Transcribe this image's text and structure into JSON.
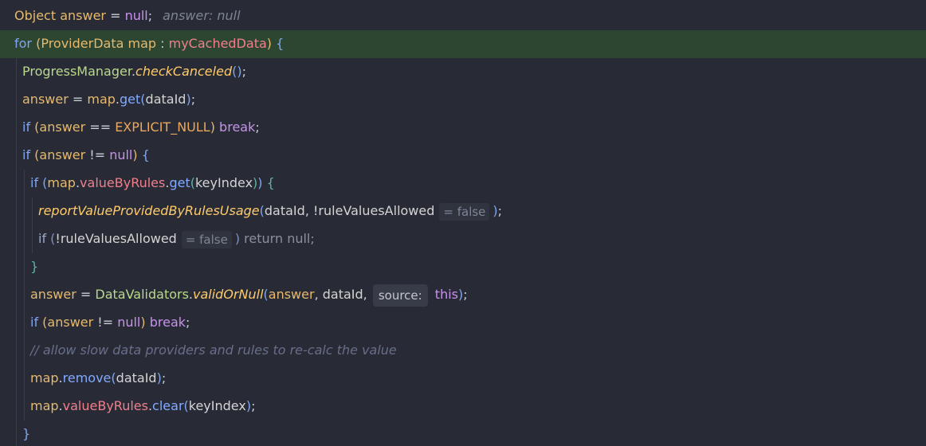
{
  "theme": {
    "colors": {
      "background": "#282b35",
      "current_line": "#2c4632",
      "indent_guide": "#3a3e4b",
      "text": "#c8ccd4",
      "keyword": "#82a4f0",
      "keyword_purple": "#c792ea",
      "type": "#e6b96e",
      "local": "#e6b96e",
      "field": "#f07f8c",
      "class": "#b8d98a",
      "static_method": "#ffcb6b",
      "method": "#82aaff",
      "param": "#d4d4d4",
      "constant": "#e9a85f",
      "comment": "#686e8a",
      "hint": "#7e8494",
      "hint_bg": "#30343f",
      "hint_box_bg": "#383c48",
      "hint_box_text": "#c4c7ce",
      "bracket_1": "#e6b96e",
      "bracket_2": "#7fa6ee",
      "bracket_3": "#5fb3a6",
      "dim": "#8a8f9b",
      "dim_keyword": "#9aa6c8",
      "dim_bracket": "#7f8fbf"
    }
  },
  "editor": {
    "current_line": 2,
    "lines": [
      {
        "depth": 0,
        "tokens": [
          {
            "text": "Object",
            "kind": "type"
          },
          {
            "text": " answer",
            "kind": "local"
          },
          {
            "text": " = ",
            "kind": "operator"
          },
          {
            "text": "null",
            "kind": "keyword-purple"
          },
          {
            "text": ";",
            "kind": "punct"
          },
          {
            "text": "answer: null",
            "kind": "hint"
          }
        ]
      },
      {
        "depth": 0,
        "tokens": [
          {
            "text": "for",
            "kind": "keyword"
          },
          {
            "text": " (",
            "kind": "bracket-1"
          },
          {
            "text": "ProviderData",
            "kind": "type"
          },
          {
            "text": " map",
            "kind": "local"
          },
          {
            "text": " : ",
            "kind": "operator"
          },
          {
            "text": "myCachedData",
            "kind": "field"
          },
          {
            "text": ")",
            "kind": "bracket-1"
          },
          {
            "text": " {",
            "kind": "bracket-2"
          }
        ]
      },
      {
        "depth": 1,
        "tokens": [
          {
            "text": "ProgressManager",
            "kind": "class"
          },
          {
            "text": ".",
            "kind": "punct"
          },
          {
            "text": "checkCanceled",
            "kind": "static-method"
          },
          {
            "text": "()",
            "kind": "bracket-2"
          },
          {
            "text": ";",
            "kind": "punct"
          }
        ]
      },
      {
        "depth": 1,
        "tokens": [
          {
            "text": "answer",
            "kind": "local"
          },
          {
            "text": " = ",
            "kind": "operator"
          },
          {
            "text": "map",
            "kind": "local"
          },
          {
            "text": ".",
            "kind": "punct"
          },
          {
            "text": "get",
            "kind": "method"
          },
          {
            "text": "(",
            "kind": "bracket-2"
          },
          {
            "text": "dataId",
            "kind": "param"
          },
          {
            "text": ")",
            "kind": "bracket-2"
          },
          {
            "text": ";",
            "kind": "punct"
          }
        ]
      },
      {
        "depth": 1,
        "tokens": [
          {
            "text": "if",
            "kind": "keyword"
          },
          {
            "text": " (",
            "kind": "bracket-1"
          },
          {
            "text": "answer",
            "kind": "local"
          },
          {
            "text": " == ",
            "kind": "operator"
          },
          {
            "text": "EXPLICIT_NULL",
            "kind": "constant"
          },
          {
            "text": ")",
            "kind": "bracket-1"
          },
          {
            "text": " break",
            "kind": "keyword-purple"
          },
          {
            "text": ";",
            "kind": "punct"
          }
        ]
      },
      {
        "depth": 1,
        "tokens": [
          {
            "text": "if",
            "kind": "keyword"
          },
          {
            "text": " (",
            "kind": "bracket-1"
          },
          {
            "text": "answer",
            "kind": "local"
          },
          {
            "text": " != ",
            "kind": "operator"
          },
          {
            "text": "null",
            "kind": "keyword-purple"
          },
          {
            "text": ")",
            "kind": "bracket-1"
          },
          {
            "text": " {",
            "kind": "bracket-2"
          }
        ]
      },
      {
        "depth": 2,
        "tokens": [
          {
            "text": "if",
            "kind": "keyword"
          },
          {
            "text": " (",
            "kind": "bracket-2"
          },
          {
            "text": "map",
            "kind": "local"
          },
          {
            "text": ".",
            "kind": "punct"
          },
          {
            "text": "valueByRules",
            "kind": "field"
          },
          {
            "text": ".",
            "kind": "punct"
          },
          {
            "text": "get",
            "kind": "method"
          },
          {
            "text": "(",
            "kind": "bracket-3"
          },
          {
            "text": "keyIndex",
            "kind": "param"
          },
          {
            "text": ")",
            "kind": "bracket-3"
          },
          {
            "text": ")",
            "kind": "bracket-2"
          },
          {
            "text": " {",
            "kind": "bracket-3"
          }
        ]
      },
      {
        "depth": 3,
        "tokens": [
          {
            "text": "reportValueProvidedByRulesUsage",
            "kind": "static-method"
          },
          {
            "text": "(",
            "kind": "bracket-2"
          },
          {
            "text": "dataId",
            "kind": "param"
          },
          {
            "text": ", ",
            "kind": "punct"
          },
          {
            "text": "!ruleValuesAllowed",
            "kind": "param"
          },
          {
            "text": "= false",
            "kind": "hint-inline"
          },
          {
            "text": ")",
            "kind": "bracket-2"
          },
          {
            "text": ";",
            "kind": "punct"
          }
        ]
      },
      {
        "depth": 3,
        "tokens": [
          {
            "text": "if",
            "kind": "dim-keyword"
          },
          {
            "text": " (",
            "kind": "dim-bracket"
          },
          {
            "text": "!ruleValuesAllowed",
            "kind": "param"
          },
          {
            "text": "= false",
            "kind": "hint-inline"
          },
          {
            "text": ")",
            "kind": "dim-bracket"
          },
          {
            "text": " return null;",
            "kind": "dim"
          }
        ]
      },
      {
        "depth": 2,
        "tokens": [
          {
            "text": "}",
            "kind": "bracket-3"
          }
        ]
      },
      {
        "depth": 2,
        "tokens": [
          {
            "text": "answer",
            "kind": "local"
          },
          {
            "text": " = ",
            "kind": "operator"
          },
          {
            "text": "DataValidators",
            "kind": "class"
          },
          {
            "text": ".",
            "kind": "punct"
          },
          {
            "text": "validOrNull",
            "kind": "static-method"
          },
          {
            "text": "(",
            "kind": "bracket-2"
          },
          {
            "text": "answer",
            "kind": "local"
          },
          {
            "text": ", ",
            "kind": "punct"
          },
          {
            "text": "dataId",
            "kind": "param"
          },
          {
            "text": ", ",
            "kind": "punct"
          },
          {
            "text": "source:",
            "kind": "hint-box"
          },
          {
            "text": " this",
            "kind": "keyword-purple"
          },
          {
            "text": ")",
            "kind": "bracket-2"
          },
          {
            "text": ";",
            "kind": "punct"
          }
        ]
      },
      {
        "depth": 2,
        "tokens": [
          {
            "text": "if",
            "kind": "keyword"
          },
          {
            "text": " (",
            "kind": "bracket-1"
          },
          {
            "text": "answer",
            "kind": "local"
          },
          {
            "text": " != ",
            "kind": "operator"
          },
          {
            "text": "null",
            "kind": "keyword-purple"
          },
          {
            "text": ")",
            "kind": "bracket-1"
          },
          {
            "text": " break",
            "kind": "keyword-purple"
          },
          {
            "text": ";",
            "kind": "punct"
          }
        ]
      },
      {
        "depth": 2,
        "tokens": [
          {
            "text": "// allow slow data providers and rules to re-calc the value",
            "kind": "comment"
          }
        ]
      },
      {
        "depth": 2,
        "tokens": [
          {
            "text": "map",
            "kind": "local"
          },
          {
            "text": ".",
            "kind": "punct"
          },
          {
            "text": "remove",
            "kind": "method"
          },
          {
            "text": "(",
            "kind": "bracket-2"
          },
          {
            "text": "dataId",
            "kind": "param"
          },
          {
            "text": ")",
            "kind": "bracket-2"
          },
          {
            "text": ";",
            "kind": "punct"
          }
        ]
      },
      {
        "depth": 2,
        "tokens": [
          {
            "text": "map",
            "kind": "local"
          },
          {
            "text": ".",
            "kind": "punct"
          },
          {
            "text": "valueByRules",
            "kind": "field"
          },
          {
            "text": ".",
            "kind": "punct"
          },
          {
            "text": "clear",
            "kind": "method"
          },
          {
            "text": "(",
            "kind": "bracket-2"
          },
          {
            "text": "keyIndex",
            "kind": "param"
          },
          {
            "text": ")",
            "kind": "bracket-2"
          },
          {
            "text": ";",
            "kind": "punct"
          }
        ]
      },
      {
        "depth": 1,
        "tokens": [
          {
            "text": "}",
            "kind": "bracket-2"
          }
        ]
      }
    ]
  }
}
